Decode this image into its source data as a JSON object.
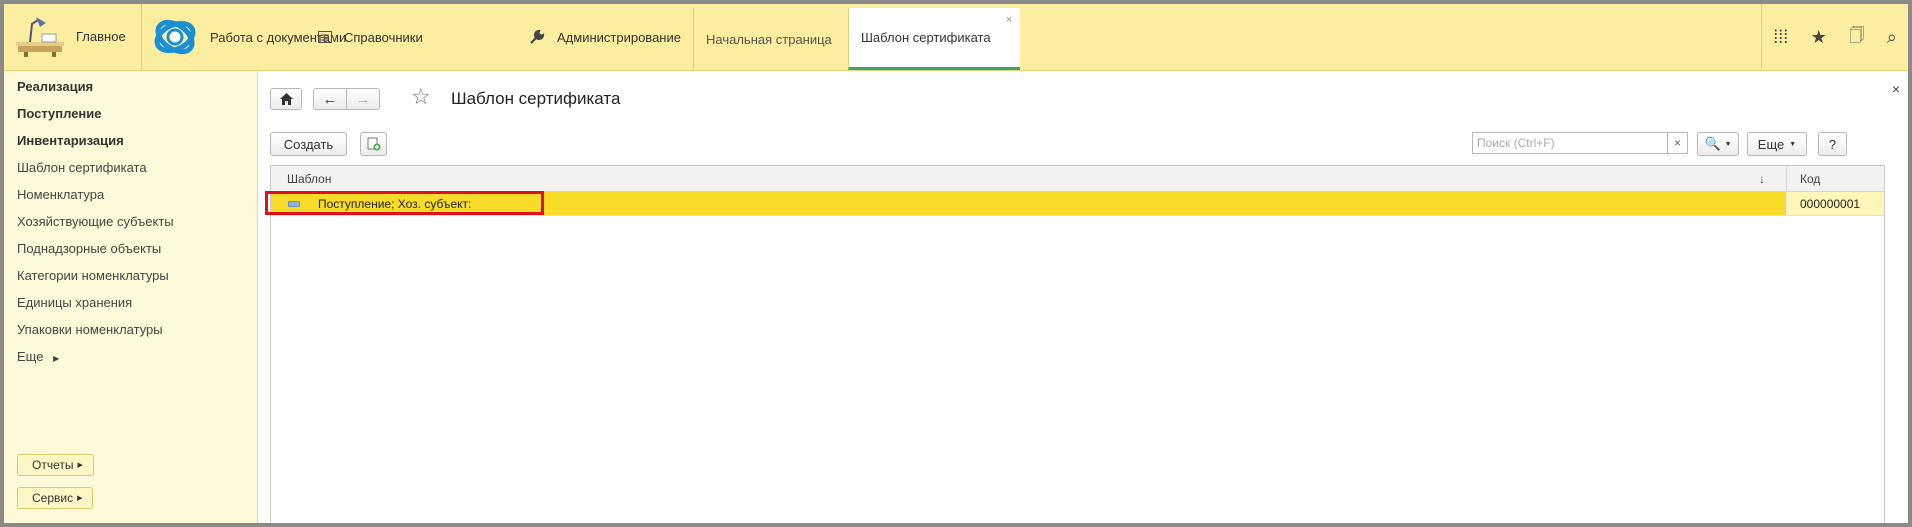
{
  "topbar": {
    "home_label": "Главное",
    "sections": [
      {
        "label": "Работа с документами",
        "icon": "docs-logo-icon"
      },
      {
        "label": "Справочники",
        "icon": "list-icon"
      },
      {
        "label": "Администрирование",
        "icon": "wrench-icon"
      }
    ],
    "tabs": [
      {
        "label": "Начальная страница"
      },
      {
        "label": "Шаблон сертификата",
        "close": "×"
      }
    ],
    "right_icons": [
      "apps-grid-icon",
      "star-icon",
      "history-icon",
      "search-icon"
    ]
  },
  "left_panel": {
    "bold_items": [
      "Реализация",
      "Поступление",
      "Инвентаризация"
    ],
    "items": [
      "Шаблон сертификата",
      "Номенклатура",
      "Хозяйствующие субъекты",
      "Поднадзорные объекты",
      "Категории номенклатуры",
      "Единицы хранения",
      "Упаковки номенклатуры"
    ],
    "more": "Еще",
    "reports": "Отчеты",
    "service": "Сервис"
  },
  "form": {
    "title": "Шаблон сертификата",
    "create": "Создать",
    "search_placeholder": "Поиск (Ctrl+F)",
    "search_clear": "×",
    "more": "Еще",
    "help": "?",
    "close": "×"
  },
  "table": {
    "columns": [
      "Шаблон",
      "Код"
    ],
    "sort_indicator": "↓",
    "rows": [
      {
        "template": "Поступление; Хоз. субъект:",
        "code": "000000001"
      }
    ]
  },
  "colors": {
    "topbar_bg": "#fbeea1",
    "left_panel_bg": "#fdfad9",
    "selected_row": "#f9dc2a",
    "highlight_border": "#e0101e",
    "active_tab_underline": "#3aa56d"
  }
}
